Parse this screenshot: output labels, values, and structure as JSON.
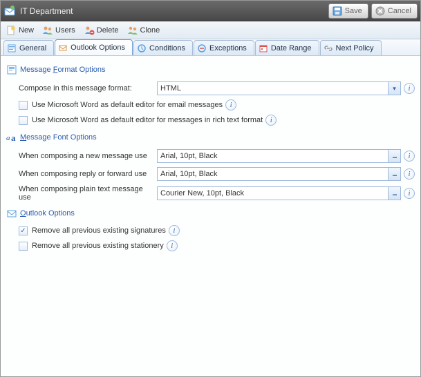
{
  "titlebar": {
    "title": "IT Department",
    "save_label": "Save",
    "cancel_label": "Cancel"
  },
  "toolbar": {
    "new_label": "New",
    "users_label": "Users",
    "delete_label": "Delete",
    "clone_label": "Clone"
  },
  "tabs": {
    "general": "General",
    "outlook_options": "Outlook Options",
    "conditions": "Conditions",
    "exceptions": "Exceptions",
    "date_range": "Date Range",
    "next_policy": "Next Policy"
  },
  "sections": {
    "message_format": {
      "title_pre": "Message ",
      "title_key": "F",
      "title_post": "ormat Options",
      "compose_label": "Compose in this message format:",
      "compose_value": "HTML",
      "word_email": "Use Microsoft Word as default editor for email messages",
      "word_rtf": "Use Microsoft Word as default editor for messages in rich text format"
    },
    "message_font": {
      "title_pre": "",
      "title_key": "M",
      "title_post": "essage Font Options",
      "new_msg_label": "When composing a new message use",
      "new_msg_value": "Arial, 10pt,  Black",
      "reply_label": "When composing reply or forward use",
      "reply_value": "Arial, 10pt,  Black",
      "plain_label": "When composing plain text message use",
      "plain_value": "Courier New, 10pt,  Black"
    },
    "outlook_options": {
      "title_pre": "",
      "title_key": "O",
      "title_post": "utlook Options",
      "remove_sig": "Remove all previous existing signatures",
      "remove_stationery": "Remove all previous existing stationery"
    }
  },
  "state": {
    "remove_sig_checked": true
  }
}
